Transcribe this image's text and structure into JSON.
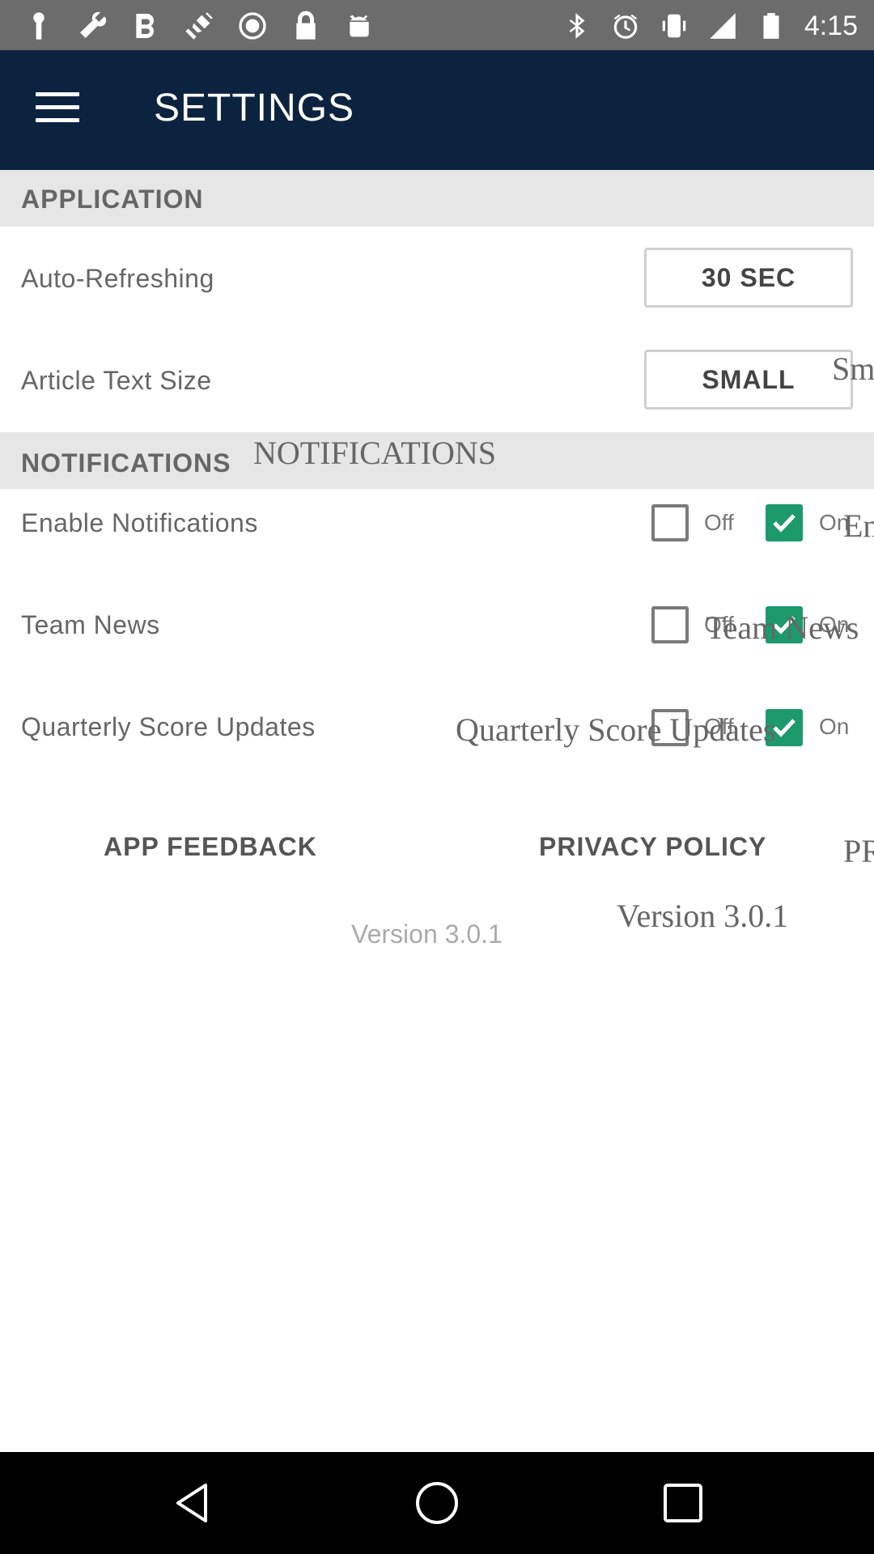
{
  "status_bar": {
    "time": "4:15",
    "left_icons": [
      "keyhole-icon",
      "wrench-icon",
      "b-icon",
      "satellite-icon",
      "record-icon",
      "lock-icon",
      "android-icon"
    ],
    "right_icons": [
      "bluetooth-icon",
      "alarm-icon",
      "vibrate-icon",
      "signal-icon",
      "battery-icon"
    ]
  },
  "app_bar": {
    "title": "SETTINGS",
    "menu_icon": "hamburger-menu-icon"
  },
  "sections": {
    "application": {
      "header": "APPLICATION",
      "auto_refreshing": {
        "label": "Auto-Refreshing",
        "value": "30 SEC"
      },
      "article_text_size": {
        "label": "Article Text Size",
        "value": "SMALL"
      }
    },
    "notifications": {
      "header": "NOTIFICATIONS",
      "off_label": "Off",
      "on_label": "On",
      "rows": [
        {
          "label": "Enable Notifications",
          "off_checked": false,
          "on_checked": true
        },
        {
          "label": "Team News",
          "off_checked": false,
          "on_checked": true
        },
        {
          "label": "Quarterly Score Updates",
          "off_checked": false,
          "on_checked": true
        }
      ]
    }
  },
  "footer": {
    "app_feedback": "APP FEEDBACK",
    "privacy_policy": "PRIVACY POLICY",
    "version": "Version 3.0.1"
  },
  "overlay_ghost_text": {
    "small": "Sm",
    "notifications": "NOTIFICATIONS",
    "enable": "En",
    "team_news": "Team News",
    "quarterly": "Quarterly Score Updates",
    "privacy": "PR",
    "version": "Version 3.0.1"
  },
  "nav_bar": {
    "back": "back-icon",
    "home": "home-icon",
    "recents": "recents-icon"
  },
  "colors": {
    "app_bar": "#0c2340",
    "checkbox_on": "#1c9a6c",
    "section_header_bg": "#e6e6e6"
  }
}
